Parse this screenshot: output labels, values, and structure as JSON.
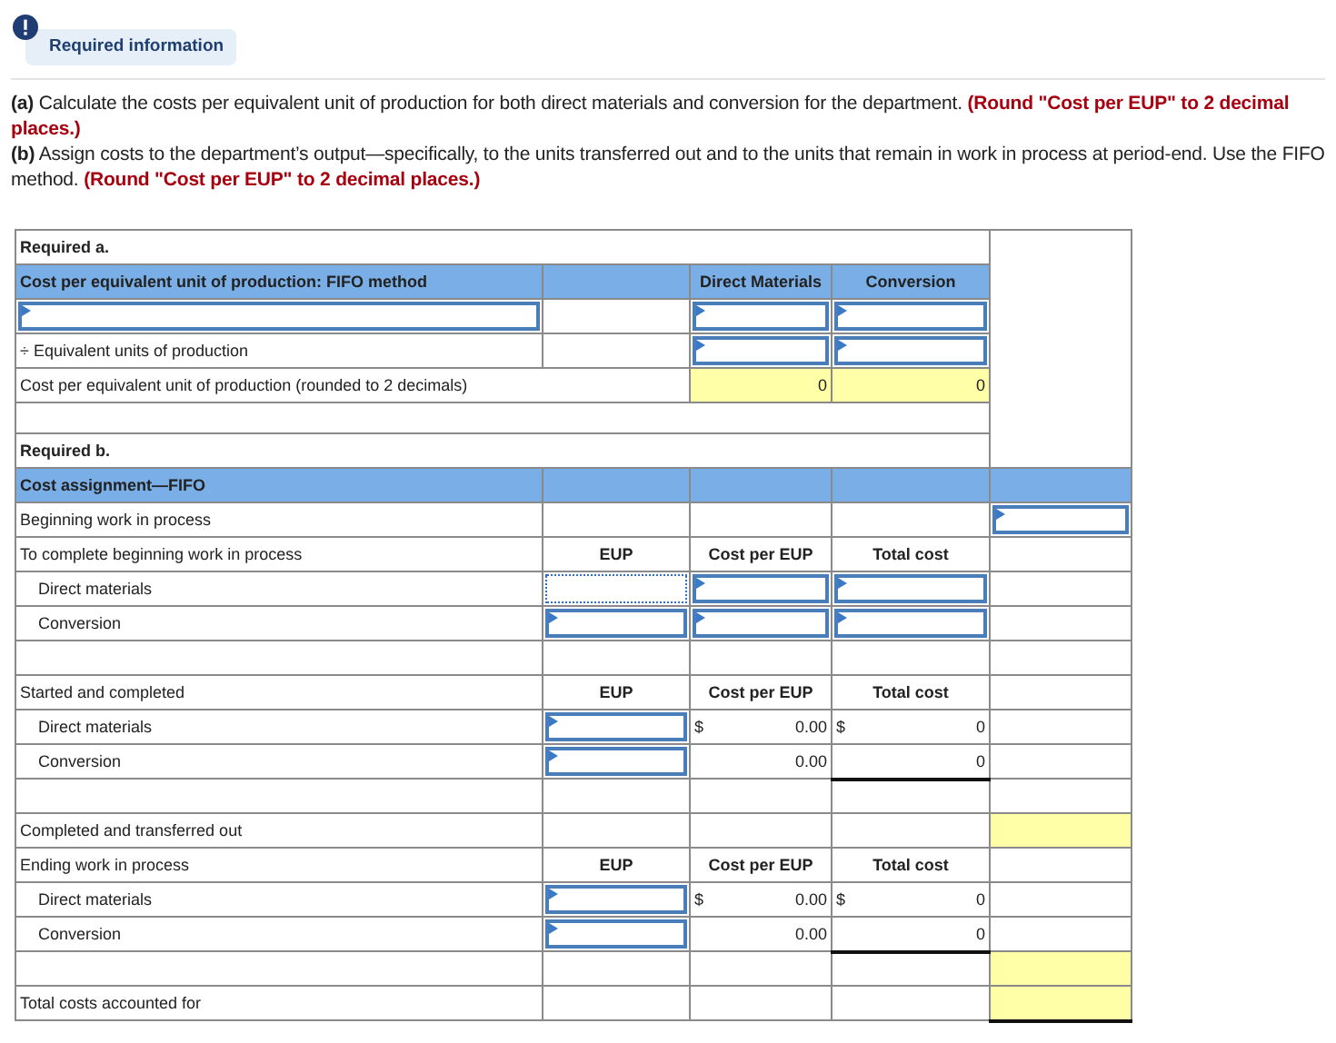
{
  "notice": {
    "label": "Required information"
  },
  "instructions": [
    "**(a)** Calculate the costs per equivalent unit of production for both direct materials and conversion for the department. **(Round \"Cost per EUP\" to 2 decimal places.)**",
    "**(b)** Assign costs to the department’s output—specifically, to the units transferred out and to the units that remain in work in process at period-end. Use the FIFO method. **(Round \"Cost per EUP\" to 2 decimal places.)**"
  ],
  "table": {
    "rows": [
      {
        "kind": "title",
        "cells": [
          {
            "kind": "text",
            "text": "Required a."
          },
          {
            "kind": "open"
          },
          {
            "kind": "open"
          },
          {
            "kind": "open"
          },
          {
            "kind": "gap"
          }
        ]
      },
      {
        "kind": "band",
        "cells": [
          {
            "kind": "text",
            "text": "Cost per equivalent unit of production: FIFO method"
          },
          {
            "kind": "empty"
          },
          {
            "kind": "head",
            "text": "Direct Materials"
          },
          {
            "kind": "head",
            "text": "Conversion"
          },
          {
            "kind": "gap"
          }
        ]
      },
      {
        "kind": "row",
        "cells": [
          {
            "kind": "input"
          },
          {
            "kind": "empty"
          },
          {
            "kind": "input"
          },
          {
            "kind": "input"
          },
          {
            "kind": "gap"
          }
        ]
      },
      {
        "kind": "row",
        "cells": [
          {
            "kind": "text",
            "text": "÷ Equivalent units of production"
          },
          {
            "kind": "empty"
          },
          {
            "kind": "input"
          },
          {
            "kind": "input"
          },
          {
            "kind": "gap"
          }
        ]
      },
      {
        "kind": "row",
        "cells": [
          {
            "kind": "text",
            "text": "Cost per equivalent unit of production (rounded to 2 decimals)"
          },
          {
            "kind": "open"
          },
          {
            "kind": "calc",
            "value": "0"
          },
          {
            "kind": "calc",
            "value": "0"
          },
          {
            "kind": "gap"
          }
        ]
      },
      {
        "kind": "spacer",
        "cells": [
          {
            "kind": "empty"
          },
          {
            "kind": "open"
          },
          {
            "kind": "open"
          },
          {
            "kind": "open"
          },
          {
            "kind": "gap"
          }
        ]
      },
      {
        "kind": "title",
        "cells": [
          {
            "kind": "text",
            "text": "Required b."
          },
          {
            "kind": "open"
          },
          {
            "kind": "open"
          },
          {
            "kind": "open"
          },
          {
            "kind": "gap"
          }
        ]
      },
      {
        "kind": "band",
        "cells": [
          {
            "kind": "text",
            "text": "Cost assignment—FIFO"
          },
          {
            "kind": "empty"
          },
          {
            "kind": "empty"
          },
          {
            "kind": "empty"
          },
          {
            "kind": "empty"
          }
        ]
      },
      {
        "kind": "row",
        "cells": [
          {
            "kind": "text",
            "text": "Beginning work in process"
          },
          {
            "kind": "empty"
          },
          {
            "kind": "empty"
          },
          {
            "kind": "empty"
          },
          {
            "kind": "input"
          }
        ]
      },
      {
        "kind": "row",
        "cells": [
          {
            "kind": "text",
            "text": "To complete beginning work in process"
          },
          {
            "kind": "head",
            "text": "EUP"
          },
          {
            "kind": "head",
            "text": "Cost per EUP"
          },
          {
            "kind": "head",
            "text": "Total cost"
          },
          {
            "kind": "empty"
          }
        ]
      },
      {
        "kind": "row",
        "cells": [
          {
            "kind": "text",
            "text": "Direct materials",
            "indent": true
          },
          {
            "kind": "input",
            "focused": true
          },
          {
            "kind": "input"
          },
          {
            "kind": "input"
          },
          {
            "kind": "empty"
          }
        ]
      },
      {
        "kind": "row",
        "cells": [
          {
            "kind": "text",
            "text": "Conversion",
            "indent": true
          },
          {
            "kind": "input"
          },
          {
            "kind": "input"
          },
          {
            "kind": "input"
          },
          {
            "kind": "empty"
          }
        ]
      },
      {
        "kind": "row",
        "cells": [
          {
            "kind": "empty"
          },
          {
            "kind": "empty"
          },
          {
            "kind": "empty"
          },
          {
            "kind": "empty"
          },
          {
            "kind": "empty"
          }
        ]
      },
      {
        "kind": "row",
        "cells": [
          {
            "kind": "text",
            "text": "Started and completed"
          },
          {
            "kind": "head",
            "text": "EUP"
          },
          {
            "kind": "head",
            "text": "Cost per EUP"
          },
          {
            "kind": "head",
            "text": "Total cost"
          },
          {
            "kind": "empty"
          }
        ]
      },
      {
        "kind": "row",
        "cells": [
          {
            "kind": "text",
            "text": "Direct materials",
            "indent": true
          },
          {
            "kind": "input"
          },
          {
            "kind": "amount",
            "currency": "$",
            "value": "0.00"
          },
          {
            "kind": "amount",
            "currency": "$",
            "value": "0"
          },
          {
            "kind": "empty"
          }
        ]
      },
      {
        "kind": "row",
        "cells": [
          {
            "kind": "text",
            "text": "Conversion",
            "indent": true
          },
          {
            "kind": "input"
          },
          {
            "kind": "amount",
            "value": "0.00"
          },
          {
            "kind": "amount",
            "value": "0",
            "underline": true
          },
          {
            "kind": "empty"
          }
        ]
      },
      {
        "kind": "row",
        "cells": [
          {
            "kind": "empty"
          },
          {
            "kind": "empty"
          },
          {
            "kind": "empty"
          },
          {
            "kind": "empty"
          },
          {
            "kind": "empty"
          }
        ]
      },
      {
        "kind": "row",
        "cells": [
          {
            "kind": "text",
            "text": "Completed and transferred out"
          },
          {
            "kind": "empty"
          },
          {
            "kind": "empty"
          },
          {
            "kind": "empty"
          },
          {
            "kind": "calc"
          }
        ]
      },
      {
        "kind": "row",
        "cells": [
          {
            "kind": "text",
            "text": "Ending work in process"
          },
          {
            "kind": "head",
            "text": "EUP"
          },
          {
            "kind": "head",
            "text": "Cost per EUP"
          },
          {
            "kind": "head",
            "text": "Total cost"
          },
          {
            "kind": "empty"
          }
        ]
      },
      {
        "kind": "row",
        "cells": [
          {
            "kind": "text",
            "text": "Direct materials",
            "indent": true
          },
          {
            "kind": "input"
          },
          {
            "kind": "amount",
            "currency": "$",
            "value": "0.00"
          },
          {
            "kind": "amount",
            "currency": "$",
            "value": "0"
          },
          {
            "kind": "empty"
          }
        ]
      },
      {
        "kind": "row",
        "cells": [
          {
            "kind": "text",
            "text": "Conversion",
            "indent": true
          },
          {
            "kind": "input"
          },
          {
            "kind": "amount",
            "value": "0.00"
          },
          {
            "kind": "amount",
            "value": "0",
            "underline": true
          },
          {
            "kind": "empty"
          }
        ]
      },
      {
        "kind": "row",
        "cells": [
          {
            "kind": "empty"
          },
          {
            "kind": "empty"
          },
          {
            "kind": "empty"
          },
          {
            "kind": "empty"
          },
          {
            "kind": "calc"
          }
        ]
      },
      {
        "kind": "row",
        "cells": [
          {
            "kind": "text",
            "text": "Total costs accounted for"
          },
          {
            "kind": "empty"
          },
          {
            "kind": "empty"
          },
          {
            "kind": "empty"
          },
          {
            "kind": "calc",
            "underline": true
          }
        ]
      }
    ]
  }
}
